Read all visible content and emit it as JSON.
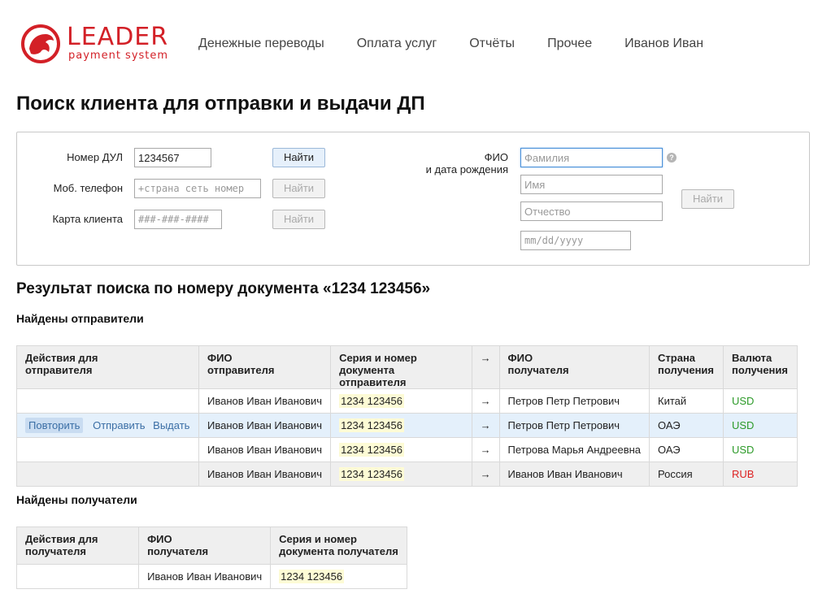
{
  "header": {
    "logo": {
      "main": "LEADER",
      "sub": "payment system"
    },
    "nav": [
      "Денежные переводы",
      "Оплата услуг",
      "Отчёты",
      "Прочее",
      "Иванов Иван"
    ]
  },
  "page_title": "Поиск клиента для отправки и выдачи ДП",
  "search": {
    "doc_label": "Номер ДУЛ",
    "doc_value": "1234567",
    "phone_label": "Моб. телефон",
    "phone_placeholder": "+страна сеть номер",
    "card_label": "Карта клиента",
    "card_placeholder": "###-###-####",
    "find_label": "Найти",
    "fio_label_line1": "ФИО",
    "fio_label_line2": "и дата рождения",
    "surname_placeholder": "Фамилия",
    "name_placeholder": "Имя",
    "patronymic_placeholder": "Отчество",
    "date_placeholder": "mm/dd/yyyy",
    "help_icon": "?"
  },
  "results_title": "Результат поиска по номеру документа «1234 123456»",
  "senders": {
    "title": "Найдены отправители",
    "headers": [
      [
        "Действия для",
        "отправителя"
      ],
      [
        "ФИО",
        "отправителя"
      ],
      [
        "Серия и номер",
        "документа отправителя"
      ],
      [
        "→",
        ""
      ],
      [
        "ФИО",
        "получателя"
      ],
      [
        "Страна",
        "получения"
      ],
      [
        "Валюта",
        "получения"
      ]
    ],
    "actions": {
      "repeat": "Повторить",
      "send": "Отправить",
      "issue": "Выдать"
    },
    "rows": [
      {
        "sender": "Иванов Иван Иванович",
        "doc": "1234 123456",
        "arrow": "→",
        "recipient": "Петров Петр Петрович",
        "country": "Китай",
        "currency": "USD"
      },
      {
        "sender": "Иванов Иван Иванович",
        "doc": "1234 123456",
        "arrow": "→",
        "recipient": "Петров Петр Петрович",
        "country": "ОАЭ",
        "currency": "USD"
      },
      {
        "sender": "Иванов Иван Иванович",
        "doc": "1234 123456",
        "arrow": "→",
        "recipient": "Петрова Марья Андреевна",
        "country": "ОАЭ",
        "currency": "USD"
      },
      {
        "sender": "Иванов Иван Иванович",
        "doc": "1234 123456",
        "arrow": "→",
        "recipient": "Иванов Иван Иванович",
        "country": "Россия",
        "currency": "RUB"
      }
    ]
  },
  "recipients": {
    "title": "Найдены получатели",
    "headers": [
      [
        "Действия для",
        "получателя"
      ],
      [
        "ФИО",
        "получателя"
      ],
      [
        "Серия и номер",
        "документа получателя"
      ]
    ],
    "rows": [
      {
        "name": "Иванов Иван Иванович",
        "doc": "1234 123456"
      }
    ]
  },
  "colors": {
    "brand": "#d32027",
    "usd": "#2c9a28",
    "rub": "#dd2222",
    "link": "#3a6ea5",
    "highlight_row": "#e4f0fb"
  }
}
